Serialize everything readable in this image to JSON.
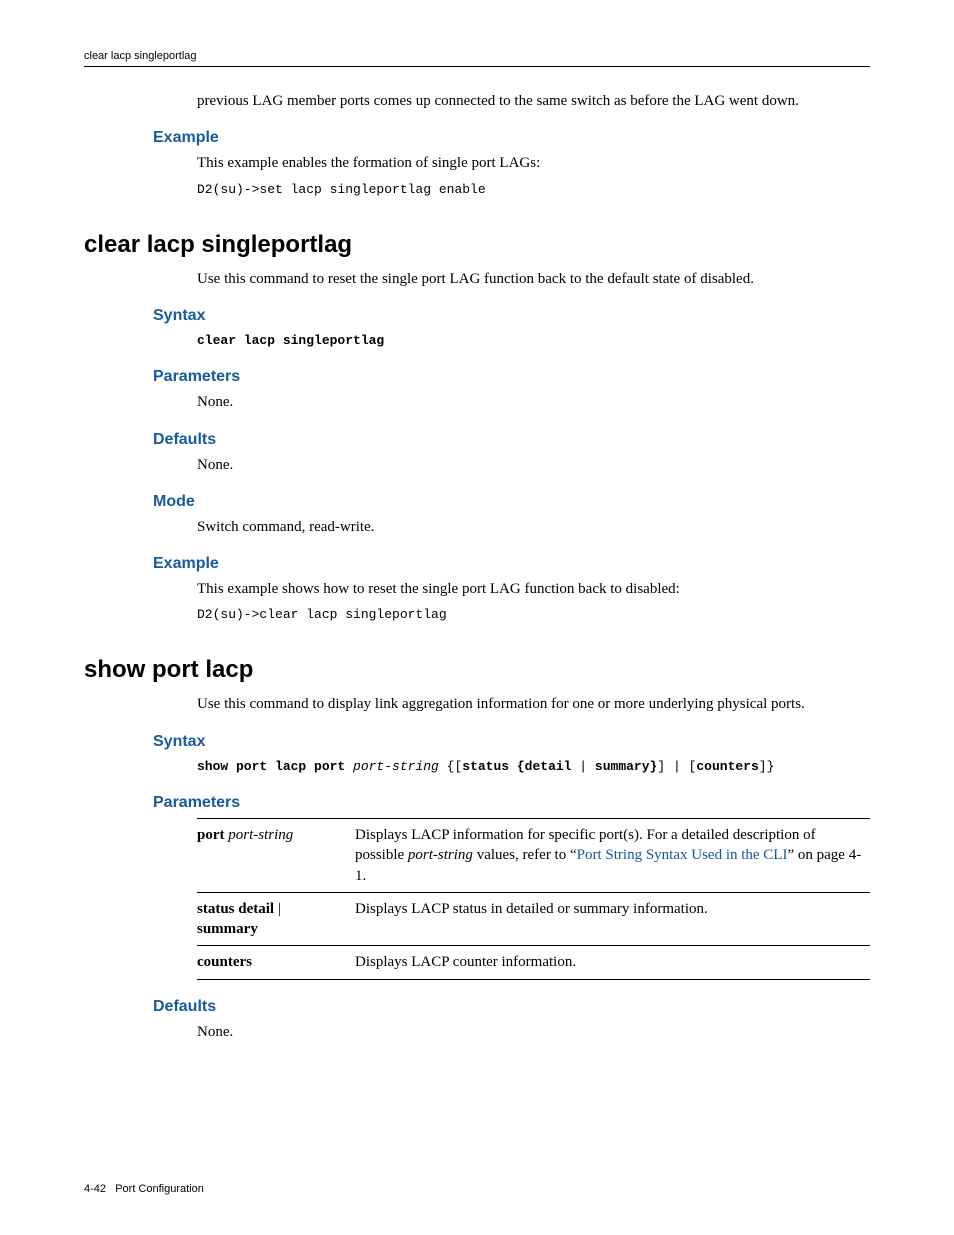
{
  "header": {
    "running": "clear lacp singleportlag"
  },
  "intro_continued": "previous LAG member ports comes up connected to the same switch as before the LAG went down.",
  "sec0": {
    "example_h": "Example",
    "example_p": "This example enables the formation of single port LAGs:",
    "example_code": "D2(su)->set lacp singleportlag enable"
  },
  "cmd1": {
    "title": "clear lacp singleportlag",
    "desc": "Use this command to reset the single port LAG function back to the default state of disabled.",
    "syntax_h": "Syntax",
    "syntax_code": "clear lacp singleportlag",
    "params_h": "Parameters",
    "params_p": "None.",
    "defaults_h": "Defaults",
    "defaults_p": "None.",
    "mode_h": "Mode",
    "mode_p": "Switch command, read-write.",
    "example_h": "Example",
    "example_p": "This example shows how to reset the single port LAG function back to disabled:",
    "example_code": "D2(su)->clear lacp singleportlag"
  },
  "cmd2": {
    "title": "show port lacp",
    "desc": "Use this command to display link aggregation information for one or more underlying physical ports.",
    "syntax_h": "Syntax",
    "syntax": {
      "t1": "show port lacp port ",
      "arg": "port-string",
      "t2": " {[",
      "t3": "status {detail ",
      "pipe1": "|",
      "t4": " summary}",
      "t5": "] ",
      "pipe2": "|",
      "t6": " [",
      "t7": "counters",
      "t8": "]}"
    },
    "params_h": "Parameters",
    "params": [
      {
        "k_bold": "port ",
        "k_ital": "port-string",
        "v_pre": "Displays LACP information for specific port(s). For a detailed description of possible ",
        "v_ital": "port-string",
        "v_mid": " values, refer to “",
        "v_link": "Port String Syntax Used in the CLI",
        "v_post": "” on page 4-1."
      },
      {
        "k_bold": "status detail ",
        "k_plain": "| ",
        "k_bold2": "summary",
        "v": "Displays LACP status in detailed or summary information."
      },
      {
        "k_bold": "counters",
        "v": "Displays LACP counter information."
      }
    ],
    "defaults_h": "Defaults",
    "defaults_p": "None."
  },
  "footer": {
    "pagenum": "4-42",
    "section": "Port Configuration"
  }
}
